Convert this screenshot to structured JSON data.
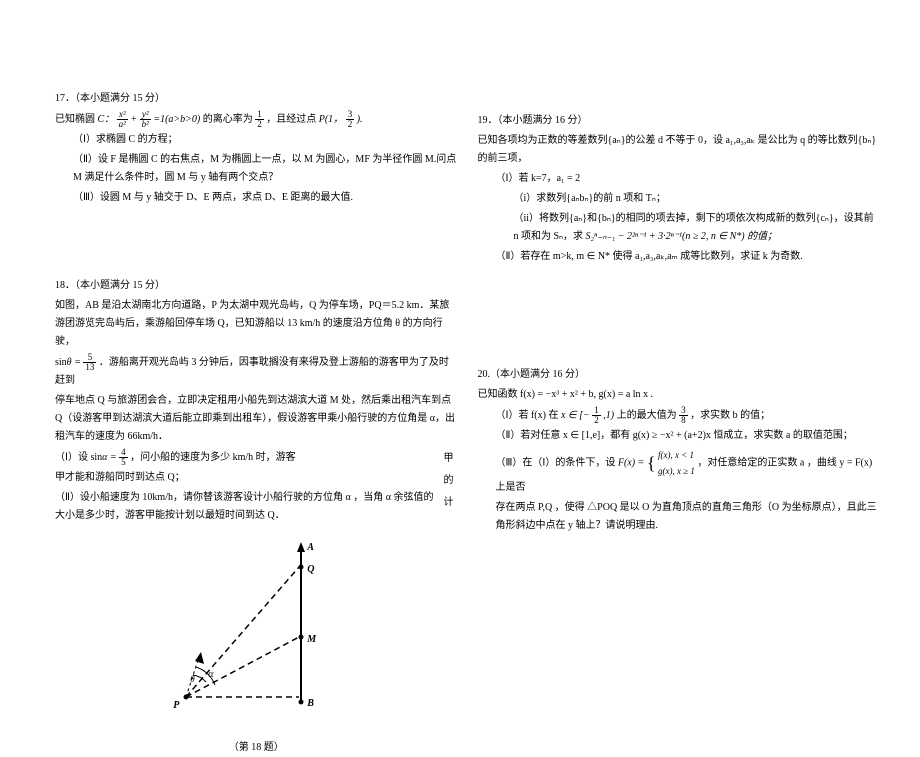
{
  "left": {
    "p17": {
      "header": "17．（本小题满分 15 分）",
      "l1a": "已知椭圆 ",
      "l1b": "的离心率为 ",
      "l1c": "，且经过点 ",
      "p1_part1": "P(1，",
      "p1_part2": ").",
      "q1": "（Ⅰ）求椭圆 C 的方程；",
      "q2": "（Ⅱ）设 F 是椭圆 C 的右焦点，M 为椭圆上一点，以 M 为圆心，MF 为半径作圆 M.问点 M 满足什么条件时，圆 M 与 y 轴有两个交点？",
      "q3": "（Ⅲ）设圆 M 与 y 轴交于 D、E 两点，求点 D、E 距离的最大值.",
      "ellipse_label": "C：",
      "ellipse_num1": "x²",
      "ellipse_den1": "a²",
      "ellipse_num2": "y²",
      "ellipse_den2": "b²",
      "ellipse_eq": "=1(a>b>0)",
      "frac12_num": "1",
      "frac12_den": "2",
      "frac32_num": "3",
      "frac32_den": "2"
    },
    "p18": {
      "header": "18．（本小题满分 15 分）",
      "l1": "如图，AB 是沿太湖南北方向道路，P 为太湖中观光岛屿，Q 为停车场，PQ＝5.2 km．某旅游团游览完岛屿后，乘游船回停车场 Q，已知游船以 13 km/h 的速度沿方位角 θ 的方向行驶，",
      "l2a": "sin",
      "l2b": "．游船离开观光岛屿 3 分钟后，因事耽搁没有来得及登上游船的游客甲为了及时赶到",
      "sin_num": "5",
      "sin_den": "13",
      "l3": "停车地点 Q 与旅游团会合，立即决定租用小船先到达湖滨大道 M 处，然后乘出租汽车到点 Q（设游客甲到达湖滨大道后能立即乘到出租车），假设游客甲乘小船行驶的方位角是 α，出租汽车的速度为 66km/h．",
      "q1a": "（Ⅰ）设 sin",
      "q1b": "，问小船的速度为多少 km/h 时，游客",
      "q1c": "甲才能和游船同时到达点 Q；",
      "sina_num": "4",
      "sina_den": "5",
      "q2a": "（Ⅱ）设小船速度为 10km/h，请你替该游客设计小船行驶的方位角 α ，当角 α 余弦值的大小是多少时，游客甲能按计划以最短时间到达 Q．",
      "side_text": "甲的计",
      "fig_caption": "（第 18 题）",
      "label_A": "A",
      "label_B": "B",
      "label_Q": "Q",
      "label_M": "M",
      "label_P": "P",
      "label_alpha": "α",
      "label_theta": "θ"
    }
  },
  "right": {
    "p19": {
      "header": "19．（本小题满分 16 分）",
      "l1": "已知各项均为正数的等差数列{aₙ}的公差 d 不等于 0，设 a₁,a₃,aₖ 是公比为 q 的等比数列{bₙ}的前三项，",
      "q1": "（Ⅰ）若 k=7，a₁ = 2",
      "q1i": "（i）求数列{aₙbₙ}的前 n 项和 Tₙ；",
      "q1ii_a": "（ii）将数列{aₙ}和{bₙ}的相同的项去掉，剩下的项依次构成新的数列{cₙ}，设其前 n 项和为 Sₙ，求 ",
      "q1ii_expr": "S₂ⁿ₋ₙ₋₁ − 2²ⁿ⁻¹ + 3·2ⁿ⁻¹(n ≥ 2, n ∈ N*) 的值；",
      "q2": "（Ⅱ）若存在 m>k, m ∈ N* 使得 a₁,a₃,aₖ,aₘ 成等比数列，求证 k 为奇数."
    },
    "p20": {
      "header": "20.（本小题满分 16 分）",
      "l1": "已知函数 f(x) = −x³ + x² + b, g(x) = a ln x .",
      "q1a": "（Ⅰ）若 f(x) 在 ",
      "q1b": " 上的最大值为 ",
      "q1c": "，求实数 b 的值；",
      "interval_a": "[−",
      "interval_b": ",1)",
      "intv_num": "1",
      "intv_den": "2",
      "max_num": "3",
      "max_den": "8",
      "q2": "（Ⅱ）若对任意 x ∈ [1,e]，都有 g(x) ≥ −x² + (a+2)x 恒成立，求实数 a 的取值范围；",
      "q3a": "（Ⅲ）在（Ⅰ）的条件下，设 ",
      "q3b": "，对任意给定的正实数 a ，曲线 y = F(x) 上是否",
      "F_label": "F(x) =",
      "F_case1": "f(x), x < 1",
      "F_case2": "g(x), x ≥ 1",
      "q3c": "存在两点 P,Q ，使得 △POQ 是以 O 为直角顶点的直角三角形（O 为坐标原点），且此三角形斜边中点在 y 轴上？请说明理由."
    }
  }
}
